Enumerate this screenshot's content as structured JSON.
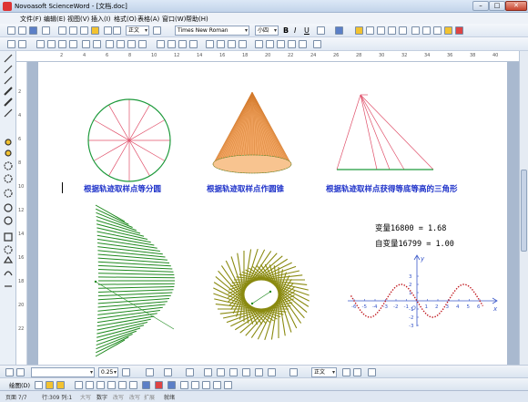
{
  "window": {
    "title": "Novoasoft ScienceWord - [文档.doc]"
  },
  "menu": [
    "文件(F)",
    "编辑(E)",
    "视图(V)",
    "插入(I)",
    "格式(O)",
    "表格(A)",
    "窗口(W)",
    "帮助(H)"
  ],
  "toolbar": {
    "style": "正文",
    "font": "Times New Roman",
    "size": "小四",
    "bold": "B",
    "italic": "I",
    "underline": "U"
  },
  "ruler_marks": [
    "2",
    "4",
    "6",
    "8",
    "10",
    "12",
    "14",
    "16",
    "18",
    "20",
    "22",
    "24",
    "26",
    "28",
    "30",
    "32",
    "34",
    "36",
    "38",
    "40"
  ],
  "vruler_marks": [
    "2",
    "4",
    "6",
    "8",
    "10",
    "12",
    "14",
    "16",
    "18",
    "20",
    "22"
  ],
  "document": {
    "captions": [
      "根据轨迹取样点等分圆",
      "根据轨迹取样点作圆锥",
      "根据轨迹取样点获得等底等高的三角形"
    ],
    "var_line1": "变量16800 = 1.68",
    "var_line2": "自变量16799 = 1.00",
    "axis_x_label": "x",
    "axis_y_label": "y",
    "x_ticks": [
      "-6",
      "-5",
      "-4",
      "-3",
      "-2",
      "-1",
      "1",
      "2",
      "3",
      "4",
      "5",
      "6"
    ],
    "y_ticks": [
      "3",
      "2",
      "1",
      "-1",
      "-2",
      "-3"
    ],
    "origin_label": "O"
  },
  "format_bar": {
    "line_width": "0.25",
    "style": "正文"
  },
  "drawing_bar": {
    "draw_label": "绘图(D)"
  },
  "status": {
    "page": "页面 7/7",
    "line_col": "行:309 列:1",
    "caps": "大写",
    "num": "数字",
    "rec": "改写",
    "ovr": "改写",
    "ext": "扩展",
    "ready": "就绪"
  },
  "colors": {
    "caption": "#1d31c9",
    "circle": "#1e9a3c",
    "spoke": "#e0506a",
    "cone": "#f3a866",
    "envelope": "#1f8a1f",
    "olive": "#8a8a10",
    "curve": "#c0181e",
    "axis": "#3a58c9"
  }
}
